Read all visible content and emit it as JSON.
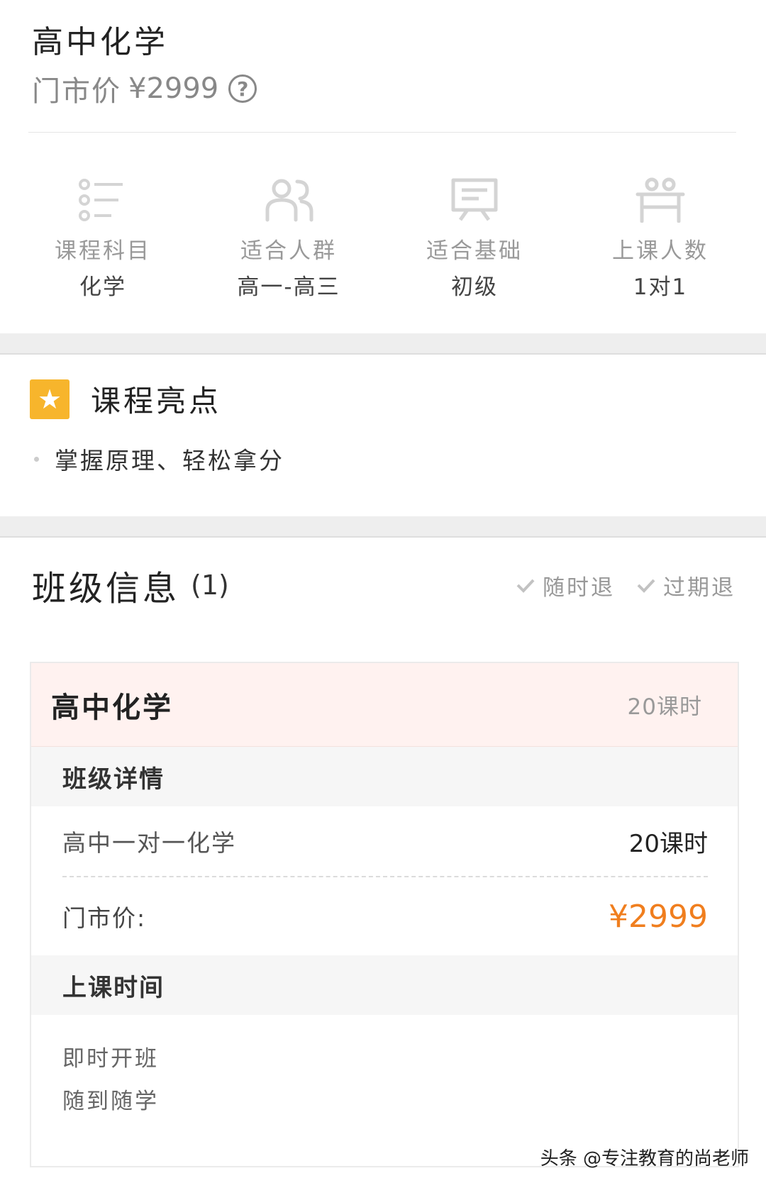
{
  "header": {
    "title": "高中化学",
    "price_label": "门市价",
    "price_value": "¥2999",
    "help_icon": "?"
  },
  "attributes": [
    {
      "icon": "list-icon",
      "label": "课程科目",
      "value": "化学"
    },
    {
      "icon": "people-icon",
      "label": "适合人群",
      "value": "高一-高三"
    },
    {
      "icon": "board-icon",
      "label": "适合基础",
      "value": "初级"
    },
    {
      "icon": "seat-icon",
      "label": "上课人数",
      "value": "1对1"
    }
  ],
  "highlights": {
    "title": "课程亮点",
    "items": [
      "掌握原理、轻松拿分"
    ],
    "icon_color": "#f7b52c"
  },
  "class_info": {
    "title": "班级信息",
    "count": "(1)",
    "tags": [
      "随时退",
      "过期退"
    ]
  },
  "card": {
    "title": "高中化学",
    "hours": "20课时",
    "detail_section": "班级详情",
    "detail_name": "高中一对一化学",
    "detail_hours": "20课时",
    "price_label": "门市价:",
    "price_value": "¥2999",
    "price_color": "#f07e1e",
    "schedule_section": "上课时间",
    "schedule_lines": [
      "即时开班",
      "随到随学"
    ]
  },
  "watermark": "头条 @专注教育的尚老师"
}
